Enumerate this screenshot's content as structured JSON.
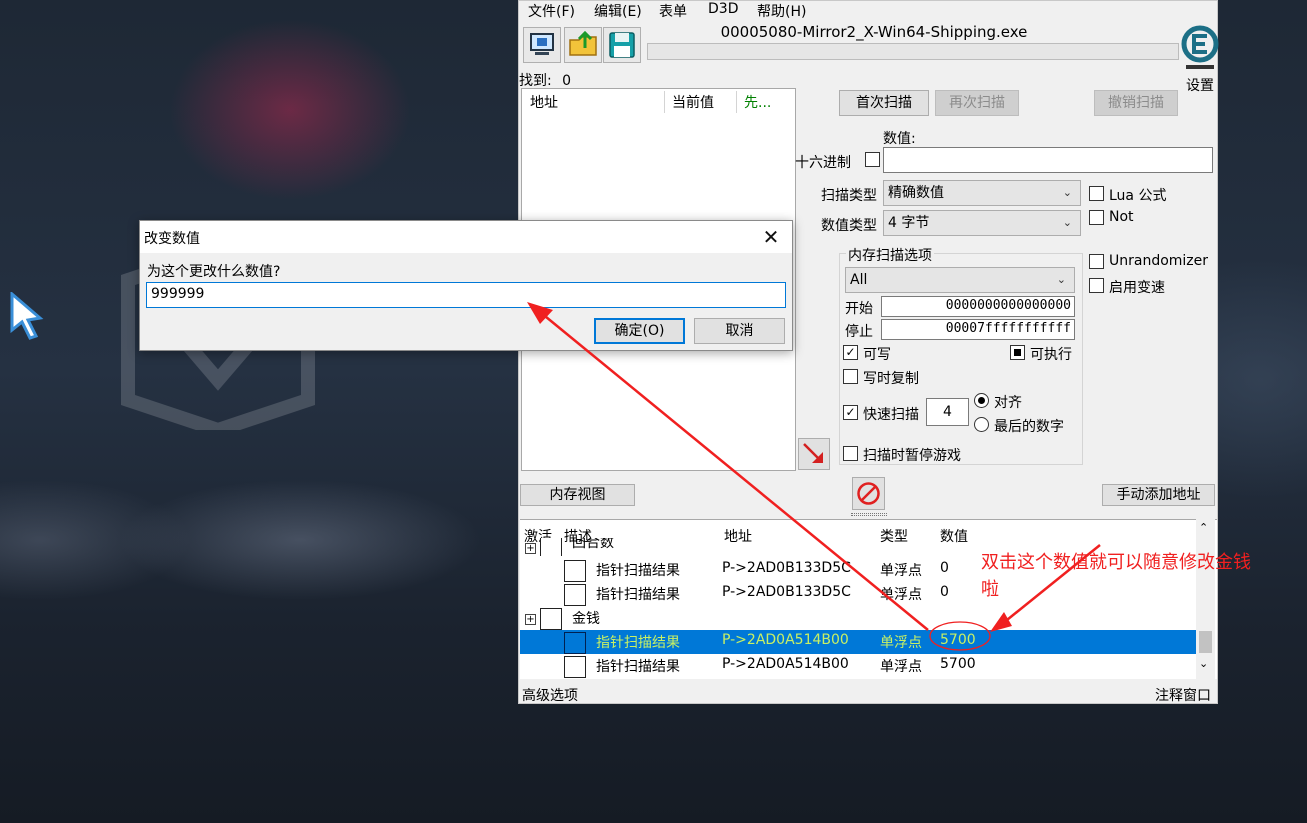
{
  "menu": {
    "items": [
      {
        "label": "文件(F)"
      },
      {
        "label": "编辑(E)"
      },
      {
        "label": "表单"
      },
      {
        "label": "D3D"
      },
      {
        "label": "帮助(H)"
      }
    ]
  },
  "process_title": "00005080-Mirror2_X-Win64-Shipping.exe",
  "settings_label": "设置",
  "found": {
    "label": "找到:",
    "count": "0"
  },
  "result_list": {
    "headers": [
      "地址",
      "当前值",
      "先..."
    ]
  },
  "scan": {
    "first_scan": "首次扫描",
    "next_scan": "再次扫描",
    "undo_scan": "撤销扫描",
    "value_label": "数值:",
    "hex_label": "十六进制",
    "scan_type_label": "扫描类型",
    "scan_type_value": "精确数值",
    "value_type_label": "数值类型",
    "value_type_value": "4 字节",
    "lua_label": "Lua 公式",
    "not_label": "Not",
    "unrandomizer_label": "Unrandomizer",
    "speedhack_label": "启用变速"
  },
  "mem_options": {
    "title": "内存扫描选项",
    "region": "All",
    "start_label": "开始",
    "start_value": "0000000000000000",
    "stop_label": "停止",
    "stop_value": "00007fffffffffff",
    "writable_label": "可写",
    "executable_label": "可执行",
    "copy_on_write_label": "写时复制",
    "fast_scan_label": "快速扫描",
    "fast_scan_value": "4",
    "align_label": "对齐",
    "last_digits_label": "最后的数字",
    "pause_label": "扫描时暂停游戏"
  },
  "memory_view_button": "内存视图",
  "add_address_button": "手动添加地址",
  "address_table": {
    "headers": {
      "active": "激活",
      "desc": "描述",
      "address": "地址",
      "type": "类型",
      "value": "数值"
    },
    "partial_group": "回合数",
    "rows": [
      {
        "desc": "指针扫描结果",
        "address": "P->2AD0B133D5C",
        "type": "单浮点",
        "value": "0"
      },
      {
        "desc": "指针扫描结果",
        "address": "P->2AD0B133D5C",
        "type": "单浮点",
        "value": "0"
      }
    ],
    "group": "金钱",
    "group_rows": [
      {
        "desc": "指针扫描结果",
        "address": "P->2AD0A514B00",
        "type": "单浮点",
        "value": "5700"
      },
      {
        "desc": "指针扫描结果",
        "address": "P->2AD0A514B00",
        "type": "单浮点",
        "value": "5700"
      }
    ]
  },
  "footer": {
    "advanced": "高级选项",
    "comments": "注释窗口"
  },
  "dialog": {
    "title": "改变数值",
    "prompt": "为这个更改什么数值?",
    "input_value": "999999",
    "ok": "确定(O)",
    "cancel": "取消"
  },
  "annotation": {
    "line1": "双击这个数值就可以随意修改金钱",
    "line2": "啦"
  },
  "colors": {
    "selection": "#0078d7",
    "annotation": "#f02020",
    "first_result_header": "#008000"
  }
}
